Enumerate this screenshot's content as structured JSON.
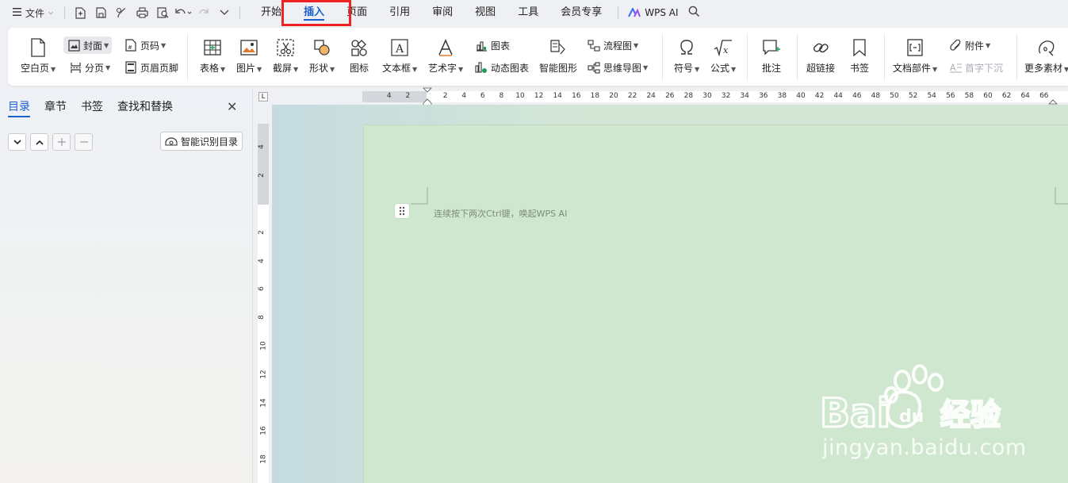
{
  "menubar": {
    "file_label": "文件",
    "tabs": [
      {
        "label": "开始",
        "active": false
      },
      {
        "label": "插入",
        "active": true
      },
      {
        "label": "页面",
        "active": false
      },
      {
        "label": "引用",
        "active": false
      },
      {
        "label": "审阅",
        "active": false
      },
      {
        "label": "视图",
        "active": false
      },
      {
        "label": "工具",
        "active": false
      },
      {
        "label": "会员专享",
        "active": false
      }
    ],
    "ai_label": "WPS AI"
  },
  "ribbon": {
    "blank_page": "空白页",
    "cover": "封面",
    "page_break": "分页",
    "page_number": "页码",
    "header_footer": "页眉页脚",
    "table": "表格",
    "picture": "图片",
    "screenshot": "截屏",
    "shape": "形状",
    "icon": "图标",
    "textbox": "文本框",
    "wordart": "艺术字",
    "chart": "图表",
    "dynamic_chart": "动态图表",
    "smartart": "智能图形",
    "flowchart": "流程图",
    "mindmap": "思维导图",
    "symbol": "符号",
    "formula": "公式",
    "comment": "批注",
    "hyperlink": "超链接",
    "bookmark": "书签",
    "doc_parts": "文档部件",
    "attachment": "附件",
    "drop_cap": "首字下沉",
    "more_materials": "更多素材"
  },
  "nav": {
    "tabs": [
      "目录",
      "章节",
      "书签",
      "查找和替换"
    ],
    "smart_toc": "智能识别目录"
  },
  "hruler": [
    "4",
    "2",
    "2",
    "4",
    "6",
    "8",
    "10",
    "12",
    "14",
    "16",
    "18",
    "20",
    "22",
    "24",
    "26",
    "28",
    "30",
    "32",
    "34",
    "36",
    "38",
    "40",
    "42",
    "44",
    "46",
    "48",
    "50",
    "52",
    "54",
    "56",
    "58",
    "60",
    "62",
    "64",
    "66"
  ],
  "vruler": [
    "4",
    "2",
    "2",
    "4",
    "6",
    "8",
    "10",
    "12",
    "14",
    "16",
    "18"
  ],
  "document": {
    "hint": "连续按下两次Ctrl键，唤起WPS AI"
  },
  "watermark": {
    "brand": "Bai du 经验",
    "domain": "jingyan.baidu.com"
  },
  "colors": {
    "accent": "#1d5fd1",
    "highlight": "#ee2222",
    "page_bg": "#cfe7ce"
  }
}
